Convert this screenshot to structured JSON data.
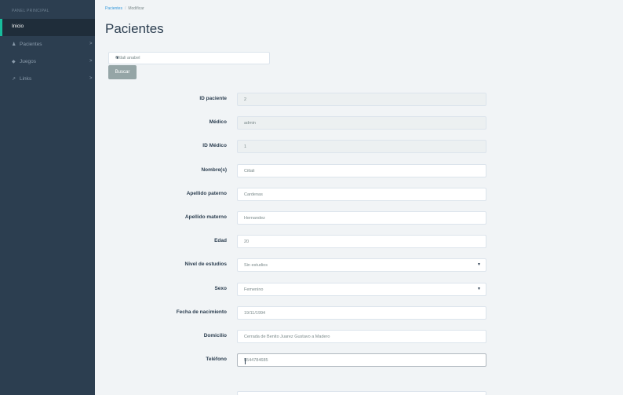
{
  "sidebar": {
    "header": "PANEL PRINCIPAL",
    "active": "Inicio",
    "items": [
      {
        "icon": "user-icon",
        "glyph": "♟",
        "label": "Pacientes"
      },
      {
        "icon": "gamepad-icon",
        "glyph": "◆",
        "label": "Juegos"
      },
      {
        "icon": "external-link-icon",
        "glyph": "↗",
        "label": "Links"
      }
    ],
    "chevron": ">"
  },
  "breadcrumb": {
    "root": "Pacientes",
    "sep": "/",
    "current": "Modificar"
  },
  "page_title": "Pacientes",
  "patient_select": {
    "value": "Citlali anabel",
    "arrow": "▼"
  },
  "search_button": "Buscar",
  "form": [
    {
      "label": "ID paciente",
      "value": "2",
      "state": "disabled"
    },
    {
      "label": "Médico",
      "value": "admin",
      "state": "disabled"
    },
    {
      "label": "ID Médico",
      "value": "1",
      "state": "disabled"
    },
    {
      "label": "Nombre(s)",
      "value": "Citlali",
      "state": "normal"
    },
    {
      "label": "Apellido paterno",
      "value": "Cardenas",
      "state": "normal"
    },
    {
      "label": "Apellido materno",
      "value": "Hernandez",
      "state": "normal"
    },
    {
      "label": "Edad",
      "value": "20",
      "state": "normal"
    },
    {
      "label": "Nivel de estudios",
      "value": "Sin estudios",
      "state": "select"
    },
    {
      "label": "Sexo",
      "value": "Femenino",
      "state": "select"
    },
    {
      "label": "Fecha de nacimiento",
      "value": "19/11/1994",
      "state": "normal"
    },
    {
      "label": "Domicilio",
      "value": "Cerrada de Benito Juarez Gustavo a Madero",
      "state": "normal"
    },
    {
      "label": "Teléfono",
      "value": "5544784685",
      "state": "focused"
    }
  ],
  "colors": {
    "sidebar": "#2c3e50",
    "accent": "#18bc9c",
    "button": "#95a5a6",
    "link": "#3498db"
  }
}
